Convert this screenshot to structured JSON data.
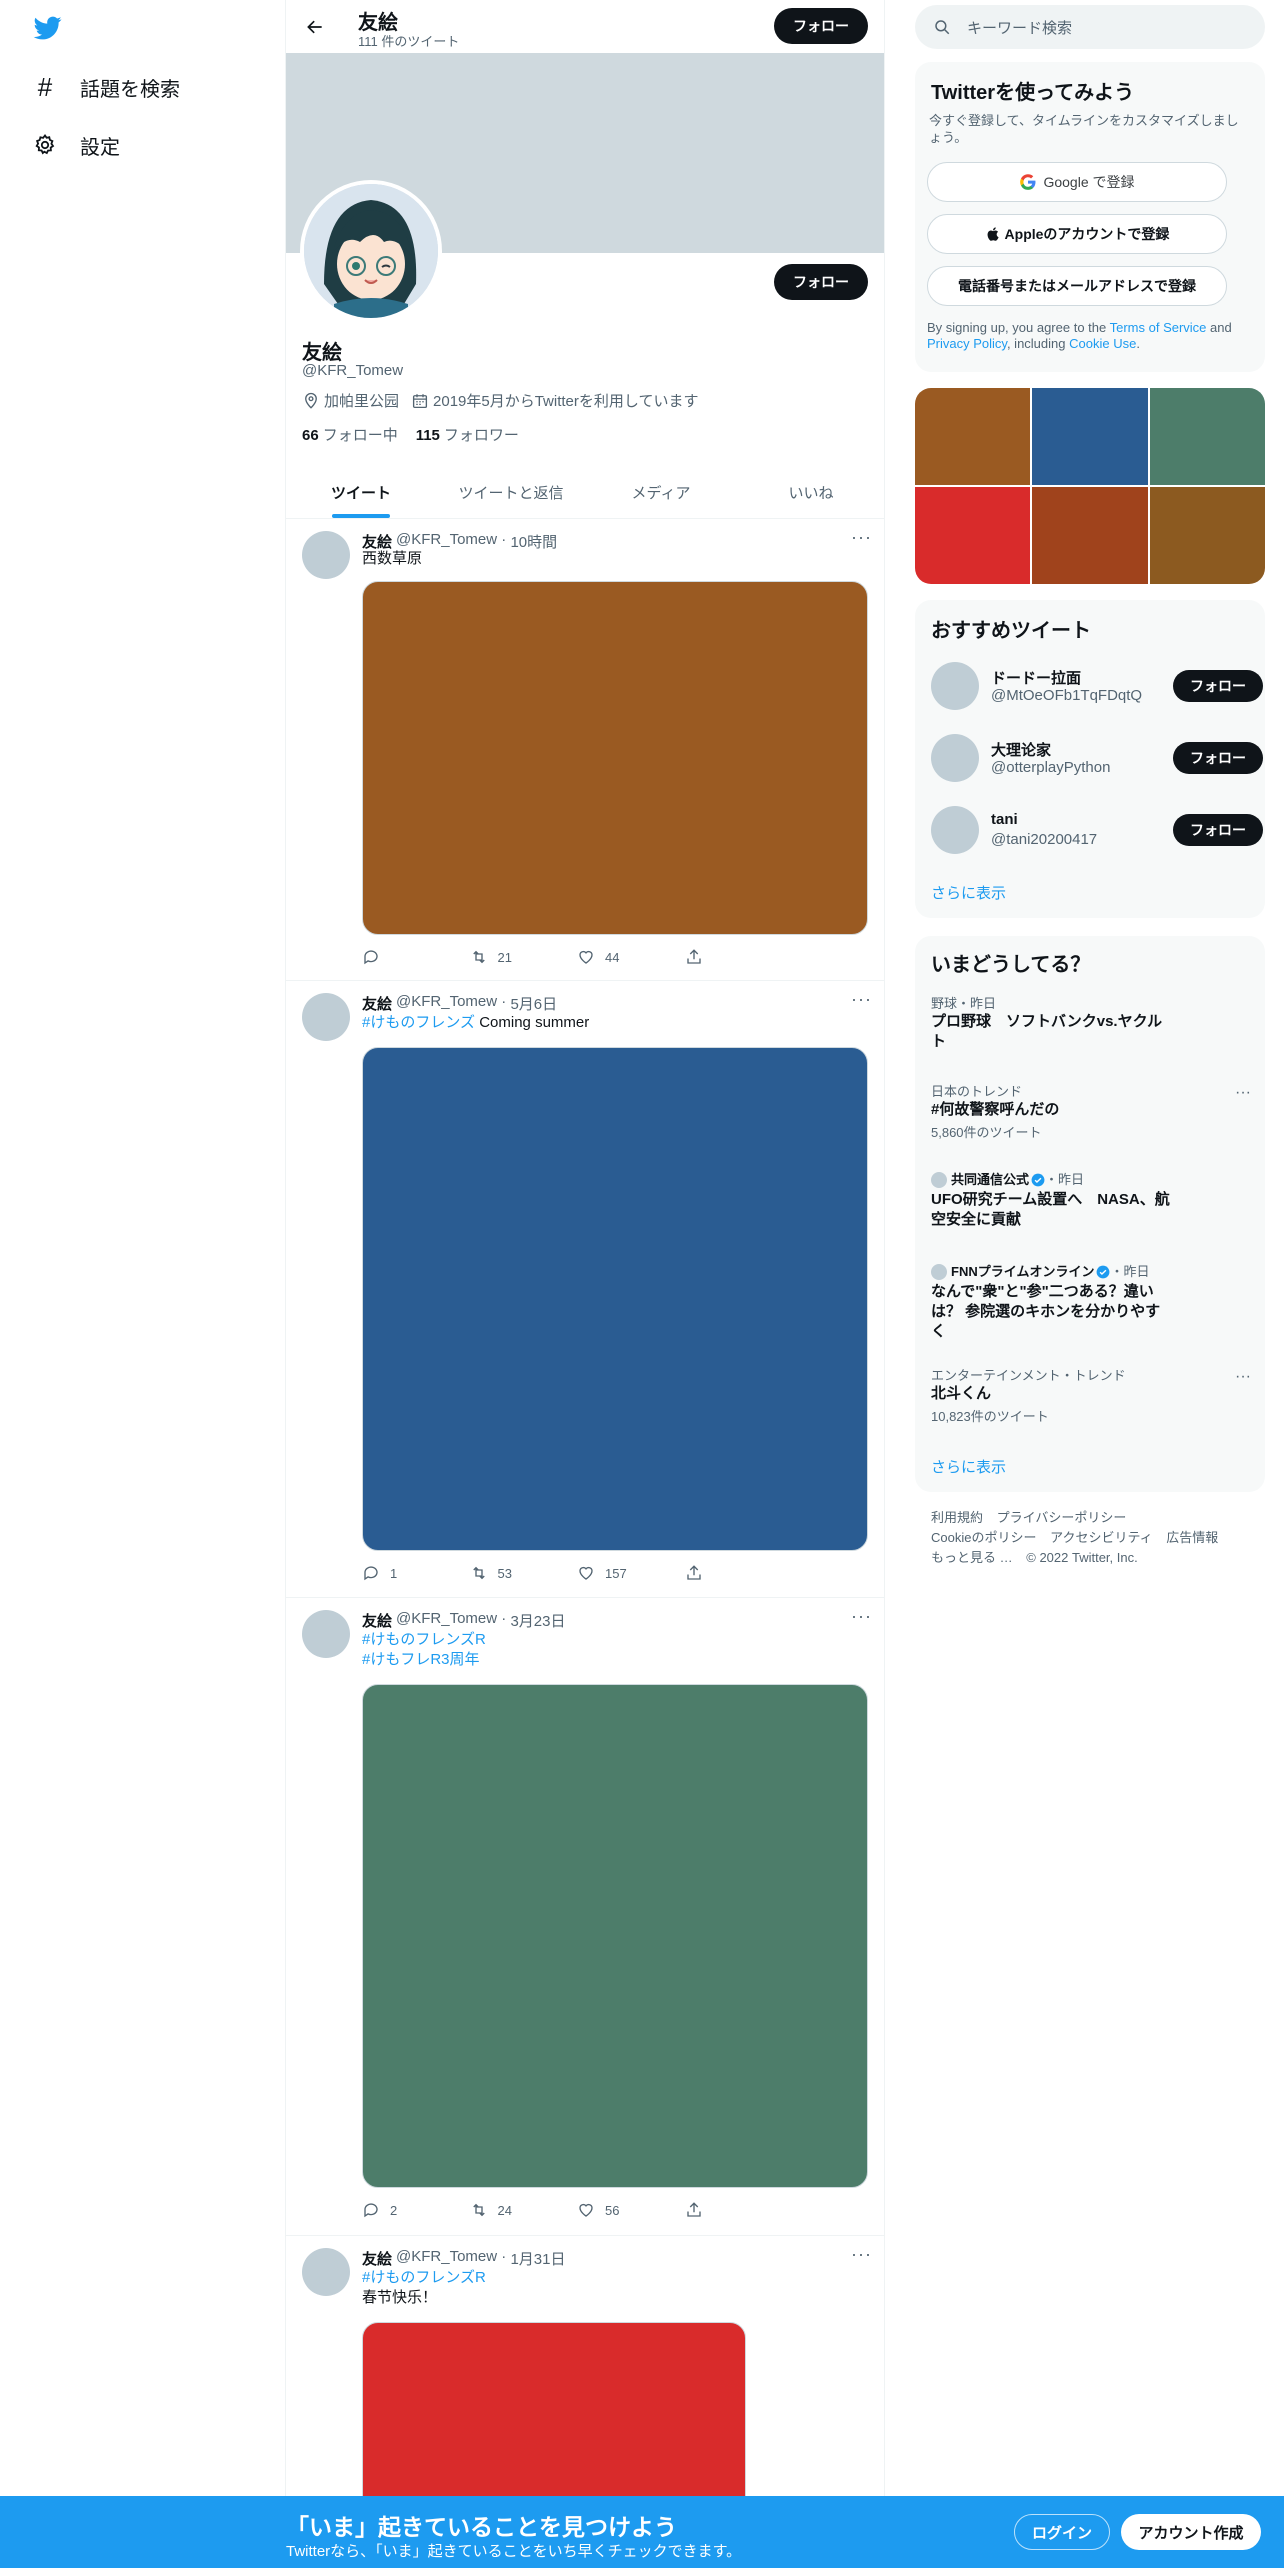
{
  "nav": {
    "explore_label": "話題を検索",
    "settings_label": "設定"
  },
  "header": {
    "name": "友絵",
    "tweet_count": "111 件のツイート",
    "follow_label": "フォロー"
  },
  "profile": {
    "name": "友絵",
    "handle": "@KFR_Tomew",
    "location": "加帕里公园",
    "joined": "2019年5月からTwitterを利用しています",
    "following_count": "66",
    "following_label": "フォロー中",
    "followers_count": "115",
    "followers_label": "フォロワー",
    "follow_label": "フォロー"
  },
  "tabs": [
    "ツイート",
    "ツイートと返信",
    "メディア",
    "いいね"
  ],
  "tweets": [
    {
      "name": "友絵",
      "handle": "@KFR_Tomew",
      "time": "10時間",
      "lines": [
        {
          "tag": "",
          "text": "西数草原"
        }
      ],
      "media_color": "#9a5a22",
      "reply": "",
      "retweet": "21",
      "like": "44"
    },
    {
      "name": "友絵",
      "handle": "@KFR_Tomew",
      "time": "5月6日",
      "lines": [
        {
          "tag": "#けものフレンズ",
          "text": " Coming summer"
        }
      ],
      "media_color": "#2a5c92",
      "reply": "1",
      "retweet": "53",
      "like": "157"
    },
    {
      "name": "友絵",
      "handle": "@KFR_Tomew",
      "time": "3月23日",
      "lines": [
        {
          "tag": "#けものフレンズR",
          "text": ""
        },
        {
          "tag": "#けもフレR3周年",
          "text": ""
        }
      ],
      "media_color": "#4d7d6a",
      "reply": "2",
      "retweet": "24",
      "like": "56"
    },
    {
      "name": "友絵",
      "handle": "@KFR_Tomew",
      "time": "1月31日",
      "lines": [
        {
          "tag": "#けものフレンズR",
          "text": ""
        },
        {
          "tag": "",
          "text": "春节快乐！"
        }
      ],
      "media_color": "#d92b2b"
    }
  ],
  "search": {
    "placeholder": "キーワード検索"
  },
  "signup": {
    "title": "Twitterを使ってみよう",
    "subtitle": "今すぐ登録して、タイムラインをカスタマイズしましょう。",
    "google_label": "Google で登録",
    "apple_label": "Appleのアカウントで登録",
    "phone_label": "電話番号またはメールアドレスで登録",
    "terms_prefix": "By signing up, you agree to the ",
    "terms_link": "Terms of Service",
    "terms_and": " and ",
    "privacy_link": "Privacy Policy",
    "terms_including": ", including ",
    "cookie_link": "Cookie Use",
    "terms_end": "."
  },
  "photo_grid": [
    "#9a5a22",
    "#2a5c92",
    "#4d7d6a",
    "#d92b2b",
    "#a0431c",
    "#8c5a20"
  ],
  "recommend": {
    "title": "おすすめツイート",
    "users": [
      {
        "name": "ドードー拉面",
        "handle": "@MtOeOFb1TqFDqtQ"
      },
      {
        "name": "大理论家",
        "handle": "@otterplayPython"
      },
      {
        "name": "tani",
        "handle": "@tani20200417"
      }
    ],
    "follow_label": "フォロー",
    "more_label": "さらに表示"
  },
  "trends": {
    "title": "いまどうしてる？",
    "items": [
      {
        "category": "野球・昨日",
        "title": "プロ野球　ソフトバンクvs.ヤクルト"
      },
      {
        "category": "日本のトレンド",
        "title": "#何故警察呼んだの",
        "count": "5,860件のツイート"
      },
      {
        "source": "共同通信公式",
        "time": "・昨日",
        "title": "UFO研究チーム設置へ　NASA、航空安全に貢献"
      },
      {
        "source": "FNNプライムオンライン",
        "time": "・昨日",
        "title": "なんで\"衆\"と\"参\"二つある？違いは？ 参院選のキホンを分かりやすく"
      },
      {
        "category": "エンターテインメント・トレンド",
        "title": "北斗くん",
        "count": "10,823件のツイート"
      }
    ],
    "more_label": "さらに表示"
  },
  "footer": {
    "links": [
      "利用規約",
      "プライバシーポリシー",
      "Cookieのポリシー",
      "アクセシビリティ",
      "広告情報",
      "もっと見る …",
      "© 2022 Twitter, Inc."
    ]
  },
  "bottom_bar": {
    "title": "「いま」起きていることを見つけよう",
    "subtitle": "Twitterなら、「いま」起きていることをいち早くチェックできます。",
    "login_label": "ログイン",
    "signup_label": "アカウント作成"
  },
  "colors": {
    "accent": "#1d9bf0",
    "banner": "#cfd9de"
  }
}
